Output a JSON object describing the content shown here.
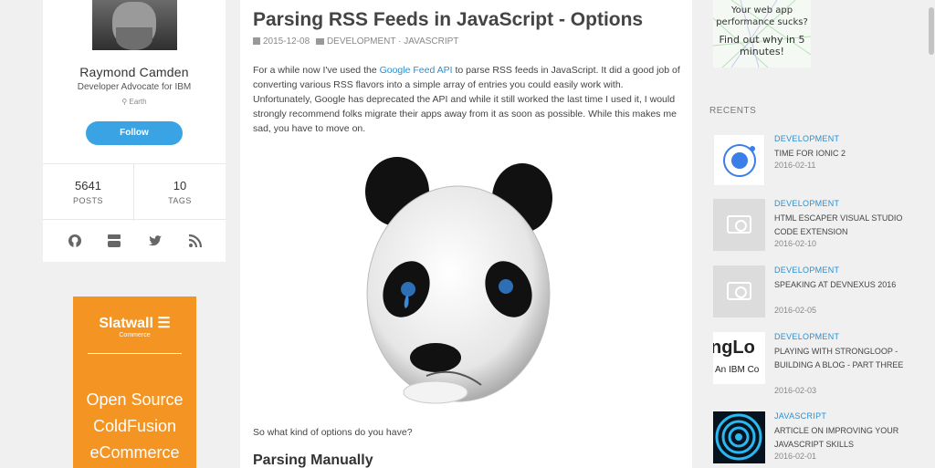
{
  "profile": {
    "name": "Raymond Camden",
    "title": "Developer Advocate for IBM",
    "location": "Earth",
    "follow_label": "Follow",
    "posts_count": "5641",
    "posts_label": "POSTS",
    "tags_count": "10",
    "tags_label": "TAGS",
    "social_icons": [
      "github-icon",
      "youtube-icon",
      "twitter-icon",
      "rss-icon"
    ]
  },
  "left_ad": {
    "brand": "Slatwall",
    "brand_sub": "Commerce",
    "line1": "Open Source",
    "line2": "ColdFusion",
    "line3": "eCommerce",
    "color": "#f49422"
  },
  "article": {
    "title": "Parsing RSS Feeds in JavaScript - Options",
    "date": "2015-12-08",
    "categories": "DEVELOPMENT · JAVASCRIPT",
    "intro_before_link": "For a while now I've used the ",
    "intro_link": "Google Feed API",
    "intro_after_link": " to parse RSS feeds in JavaScript. It did a good job of converting various RSS flavors into a simple array of entries you could easily work with. Unfortunately, Google has deprecated the API and while it still worked the last time I used it, I would strongly recommend folks migrate their apps away from it as soon as possible. While this makes me sad, you have to move on.",
    "question": "So what kind of options do you have?",
    "section_heading": "Parsing Manually"
  },
  "right_ad": {
    "line1": "Your web app",
    "line2": "performance sucks?",
    "line3": "Find out why in 5",
    "line4": "minutes!"
  },
  "recents": {
    "heading": "RECENTS",
    "items": [
      {
        "category": "DEVELOPMENT",
        "title": "TIME FOR IONIC 2",
        "date": "2016-02-11",
        "thumb": "ionic-logo"
      },
      {
        "category": "DEVELOPMENT",
        "title": "HTML ESCAPER VISUAL STUDIO CODE EXTENSION",
        "date": "2016-02-10",
        "thumb": "camera-placeholder"
      },
      {
        "category": "DEVELOPMENT",
        "title": "SPEAKING AT DEVNEXUS 2016",
        "date": "2016-02-05",
        "thumb": "camera-placeholder"
      },
      {
        "category": "DEVELOPMENT",
        "title": "PLAYING WITH STRONGLOOP - BUILDING A BLOG - PART THREE",
        "date": "2016-02-03",
        "thumb": "strongloop-logo",
        "thumb_text1": "ngLo",
        "thumb_text2": "An IBM Co"
      },
      {
        "category": "JAVASCRIPT",
        "title": "ARTICLE ON IMPROVING YOUR JAVASCRIPT SKILLS",
        "date": "2016-02-01",
        "thumb": "target-logo"
      }
    ]
  },
  "colors": {
    "accent": "#3aa3e3",
    "link": "#2a8fd1"
  }
}
